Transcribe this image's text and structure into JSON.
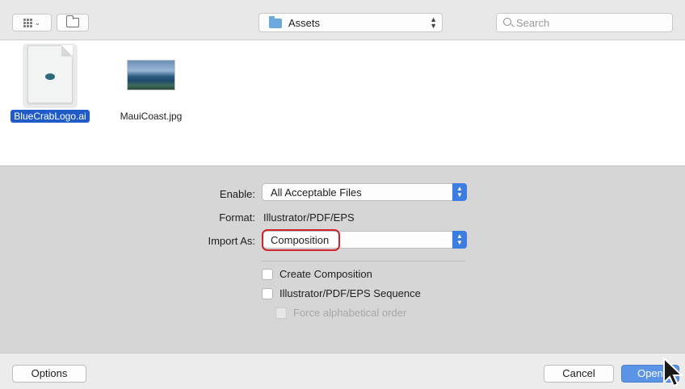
{
  "toolbar": {
    "view_icon": "icon-grid-view-icon",
    "new_folder_icon": "new-folder-icon",
    "location": "Assets",
    "search_placeholder": "Search"
  },
  "files": [
    {
      "name": "BlueCrabLogo.ai",
      "icon": "illustrator-document-icon",
      "selected": true
    },
    {
      "name": "MauiCoast.jpg",
      "icon": "image-thumbnail-icon",
      "selected": false
    }
  ],
  "options": {
    "enable_label": "Enable:",
    "enable_value": "All Acceptable Files",
    "format_label": "Format:",
    "format_value": "Illustrator/PDF/EPS",
    "import_as_label": "Import As:",
    "import_as_value": "Composition",
    "checkboxes": [
      {
        "label": "Create Composition",
        "checked": false,
        "enabled": true
      },
      {
        "label": "Illustrator/PDF/EPS Sequence",
        "checked": false,
        "enabled": true
      },
      {
        "label": "Force alphabetical order",
        "checked": false,
        "enabled": false
      }
    ]
  },
  "footer": {
    "options_label": "Options",
    "cancel_label": "Cancel",
    "open_label": "Open"
  },
  "colors": {
    "accent": "#3b7de0",
    "selection": "#1f5cc7",
    "highlight_ring": "#d2232a"
  }
}
